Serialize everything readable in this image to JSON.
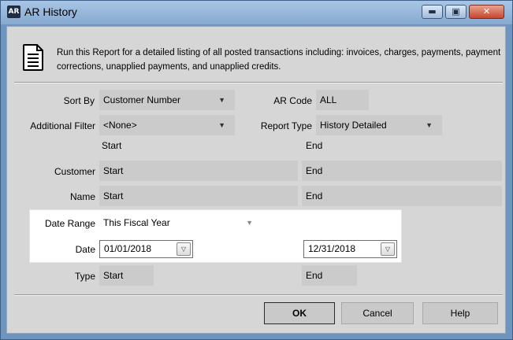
{
  "window": {
    "title": "AR History",
    "app_icon": "AR"
  },
  "description": "Run this Report for a detailed listing of all posted transactions including: invoices, charges, payments, payment corrections, unapplied payments, and unapplied credits.",
  "form": {
    "sort_by": {
      "label": "Sort By",
      "value": "Customer Number"
    },
    "ar_code": {
      "label": "AR Code",
      "value": "ALL"
    },
    "additional_filter": {
      "label": "Additional Filter",
      "value": "<None>"
    },
    "report_type": {
      "label": "Report Type",
      "value": "History Detailed"
    },
    "start_header": "Start",
    "end_header": "End",
    "customer": {
      "label": "Customer",
      "start": "Start",
      "end": "End"
    },
    "name": {
      "label": "Name",
      "start": "Start",
      "end": "End"
    },
    "date_range": {
      "label": "Date Range",
      "value": "This Fiscal Year"
    },
    "date": {
      "label": "Date",
      "start": "01/01/2018",
      "end": "12/31/2018"
    },
    "type": {
      "label": "Type",
      "start": "Start",
      "end": "End"
    }
  },
  "buttons": {
    "ok": "OK",
    "cancel": "Cancel",
    "help": "Help"
  },
  "colors": {
    "title_bar": "#86a9d0",
    "dialog_bg": "#d6d6d6",
    "field_bg": "#cbcbcb",
    "close_button": "#c7462d"
  }
}
